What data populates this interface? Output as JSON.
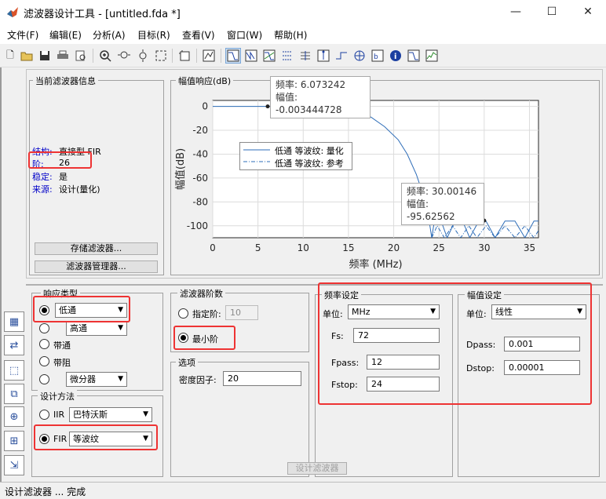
{
  "window": {
    "title": "滤波器设计工具 -  [untitled.fda *]",
    "minimize": "—",
    "maximize": "☐",
    "close": "✕"
  },
  "menu": [
    "文件(F)",
    "编辑(E)",
    "分析(A)",
    "目标(R)",
    "查看(V)",
    "窗口(W)",
    "帮助(H)"
  ],
  "toolbar": {
    "icons": [
      "new-file-icon",
      "open-icon",
      "save-icon",
      "print-icon",
      "print-preview-icon",
      "zoom-in-icon",
      "zoom-x-icon",
      "zoom-y-icon",
      "full-view-icon",
      "new-figure-icon",
      "legend-icon",
      "magnitude-response-icon",
      "phase-response-icon",
      "mag-phase-icon",
      "group-delay-icon",
      "phase-delay-icon",
      "impulse-response-icon",
      "step-response-icon",
      "pole-zero-icon",
      "filter-coefficients-icon",
      "filter-info-icon",
      "magnitude-estimate-icon",
      "round-off-noise-icon"
    ]
  },
  "filter_info": {
    "title": "当前滤波器信息",
    "structure_label": "结构:",
    "structure_value": "直接型 FIR",
    "order_label": "阶:",
    "order_value": "26",
    "stable_label": "稳定:",
    "stable_value": "是",
    "source_label": "来源:",
    "source_value": "设计(量化)",
    "store_button": "存储滤波器...",
    "manager_button": "滤波器管理器..."
  },
  "plot": {
    "title": "幅值响应(dB)",
    "tooltip1": {
      "line1": "频率: 6.073242",
      "line2": "幅值: -0.003444728"
    },
    "tooltip2": {
      "line1": "频率: 30.00146",
      "line2": "幅值: -95.62562"
    },
    "legend": [
      "低通 等波纹: 量化",
      "低通 等波纹: 参考"
    ]
  },
  "chart_data": {
    "type": "line",
    "xlabel": "频率 (MHz)",
    "ylabel": "幅值(dB)",
    "xlim": [
      0,
      36
    ],
    "ylim": [
      -110,
      5
    ],
    "xticks": [
      "0",
      "5",
      "10",
      "15",
      "20",
      "25",
      "30",
      "35"
    ],
    "yticks": [
      "0",
      "-20",
      "-40",
      "-60",
      "-80",
      "-100"
    ],
    "xtick_values": [
      0,
      5,
      10,
      15,
      20,
      25,
      30,
      35
    ],
    "ytick_values": [
      0,
      -20,
      -40,
      -60,
      -80,
      -100
    ],
    "series": [
      {
        "name": "低通 等波纹: 量化",
        "x": [
          0,
          6,
          12,
          14,
          16,
          17.5,
          19,
          20.5,
          21.5,
          22.5,
          23.3,
          23.9,
          24.2,
          24.5,
          25.2,
          25.9,
          26.8,
          27.6,
          28.4,
          29.4,
          30.2,
          31.2,
          32.3,
          33.4,
          34.5,
          35.5,
          36
        ],
        "y": [
          0,
          0,
          0,
          -1,
          -4,
          -9,
          -17,
          -28,
          -40,
          -57,
          -75,
          -95,
          -110,
          -96,
          -95,
          -110,
          -96,
          -96,
          -110,
          -96,
          -96,
          -110,
          -96,
          -96,
          -110,
          -96,
          -96
        ]
      },
      {
        "name": "低通 等波纹: 参考",
        "x": [
          24.2,
          24.8,
          25.6,
          26.5,
          27.4,
          28.3,
          29.2,
          30.2,
          31.2,
          32.3,
          33.4,
          34.5,
          35.5,
          36
        ],
        "y": [
          -110,
          -100,
          -110,
          -100,
          -110,
          -100,
          -110,
          -100,
          -110,
          -100,
          -110,
          -100,
          -110,
          -104
        ]
      }
    ],
    "markers": [
      {
        "x": 6.073242,
        "y": -0.003444728
      },
      {
        "x": 30.00146,
        "y": -95.62562
      }
    ]
  },
  "response_type": {
    "title": "响应类型",
    "lowpass": "低通",
    "highpass": "高通",
    "bandpass": "带通",
    "bandstop": "带阻",
    "differentiator": "微分器"
  },
  "design_method": {
    "title": "设计方法",
    "iir_label": "IIR",
    "iir_value": "巴特沃斯",
    "fir_label": "FIR",
    "fir_value": "等波纹"
  },
  "filter_order": {
    "title": "滤波器阶数",
    "specify_label": "指定阶:",
    "specify_value": "10",
    "minimum_label": "最小阶"
  },
  "options": {
    "title": "选项",
    "density_label": "密度因子:",
    "density_value": "20"
  },
  "freq_spec": {
    "title": "频率设定",
    "unit_label": "单位:",
    "unit_value": "MHz",
    "fs_label": "Fs:",
    "fs_value": "72",
    "fpass_label": "Fpass:",
    "fpass_value": "12",
    "fstop_label": "Fstop:",
    "fstop_value": "24"
  },
  "mag_spec": {
    "title": "幅值设定",
    "unit_label": "单位:",
    "unit_value": "线性",
    "dpass_label": "Dpass:",
    "dpass_value": "0.001",
    "dstop_label": "Dstop:",
    "dstop_value": "0.00001"
  },
  "design_button": "设计滤波器",
  "status": "设计滤波器 ... 完成"
}
